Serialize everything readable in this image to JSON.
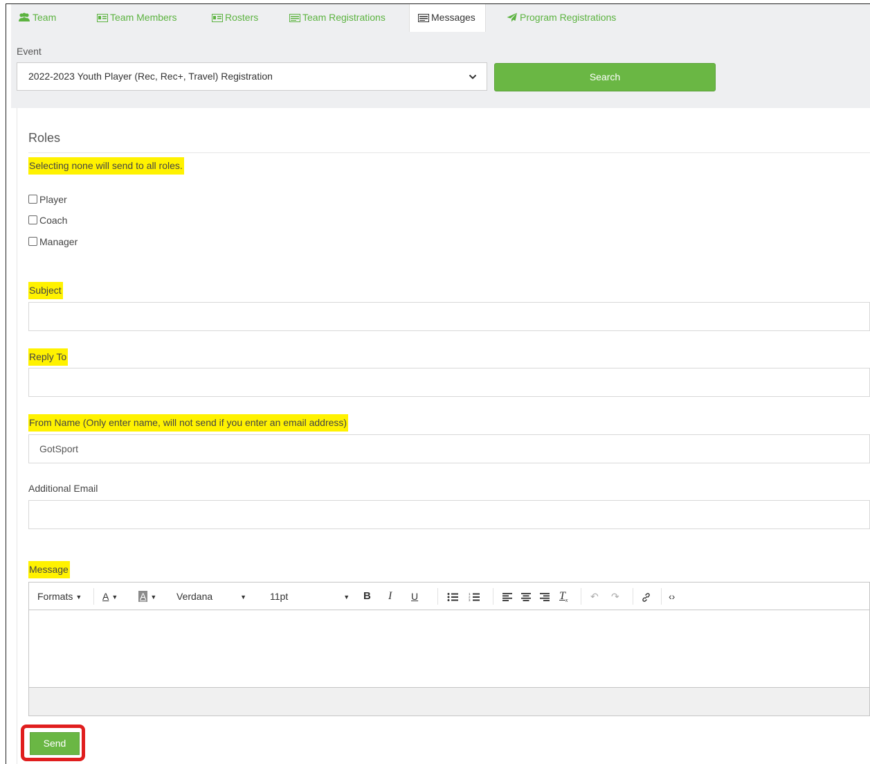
{
  "tabs": [
    {
      "label": "Team",
      "icon": "team-icon"
    },
    {
      "label": "Team Members",
      "icon": "id-card-icon"
    },
    {
      "label": "Rosters",
      "icon": "id-card-icon"
    },
    {
      "label": "Team Registrations",
      "icon": "list-icon"
    },
    {
      "label": "Messages",
      "icon": "list-icon",
      "active": true
    },
    {
      "label": "Program Registrations",
      "icon": "paper-plane-icon"
    }
  ],
  "event": {
    "label": "Event",
    "selected": "2022-2023 Youth Player (Rec, Rec+, Travel) Registration",
    "search_label": "Search"
  },
  "roles": {
    "title": "Roles",
    "hint": "Selecting none will send to all roles.",
    "options": [
      "Player",
      "Coach",
      "Manager"
    ]
  },
  "fields": {
    "subject_label": "Subject",
    "subject_value": "",
    "reply_to_label": "Reply To",
    "reply_to_value": "",
    "from_name_label": "From Name (Only enter name, will not send if you enter an email address)",
    "from_name_value": "GotSport",
    "additional_email_label": "Additional Email",
    "additional_email_value": ""
  },
  "message": {
    "label": "Message",
    "toolbar": {
      "formats": "Formats",
      "font_family": "Verdana",
      "font_size": "11pt"
    }
  },
  "send_label": "Send",
  "colors": {
    "accent_green": "#6ab744",
    "tab_text_green": "#5cb340",
    "highlight_yellow": "#fff200",
    "annotation_red": "#e01e1e"
  }
}
